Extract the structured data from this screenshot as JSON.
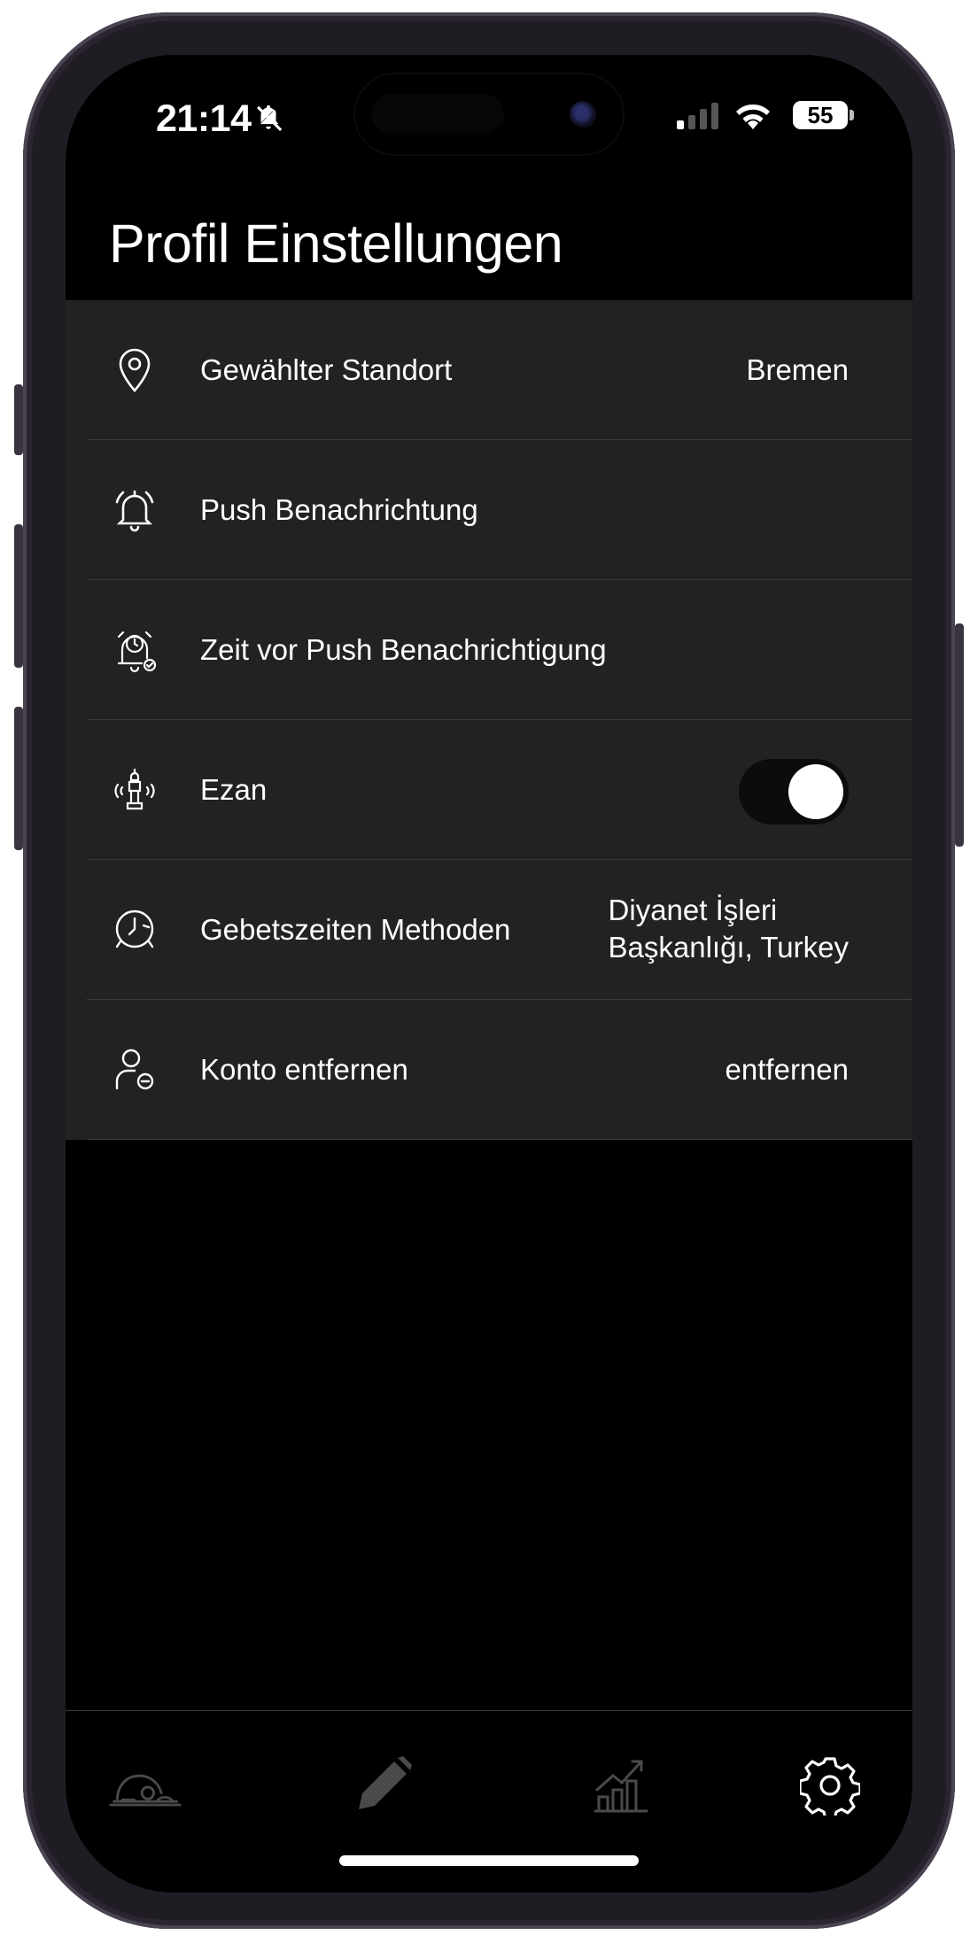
{
  "status_bar": {
    "time": "21:14",
    "battery": "55",
    "silent_icon": "bell-slash-icon",
    "signal_icon": "cellular-signal-icon",
    "wifi_icon": "wifi-icon"
  },
  "header": {
    "title": "Profil Einstellungen"
  },
  "settings": {
    "items": [
      {
        "icon": "location-pin-icon",
        "label": "Gewählter Standort",
        "value": "Bremen"
      },
      {
        "icon": "bell-icon",
        "label": "Push Benachrichtung",
        "value": ""
      },
      {
        "icon": "alarm-clock-bell-icon",
        "label": "Zeit vor Push Benachrichtigung",
        "value": ""
      },
      {
        "icon": "minaret-speaker-icon",
        "label": "Ezan",
        "toggle": true
      },
      {
        "icon": "clock-history-icon",
        "label": "Gebetszeiten Methoden",
        "value": "Diyanet İşleri\nBaşkanlığı, Turkey"
      },
      {
        "icon": "user-remove-icon",
        "label": "Konto entfernen",
        "value": "entfernen"
      }
    ]
  },
  "tab_bar": {
    "tabs": [
      {
        "icon": "prayer-person-icon",
        "active": false
      },
      {
        "icon": "pencil-icon",
        "active": false
      },
      {
        "icon": "growth-chart-icon",
        "active": false
      },
      {
        "icon": "gear-icon",
        "active": true
      }
    ]
  },
  "colors": {
    "background": "#000000",
    "row_background": "#232222",
    "divider": "#3c3c3c",
    "text": "#ffffff",
    "inactive_tab": "#4a4a4a"
  }
}
